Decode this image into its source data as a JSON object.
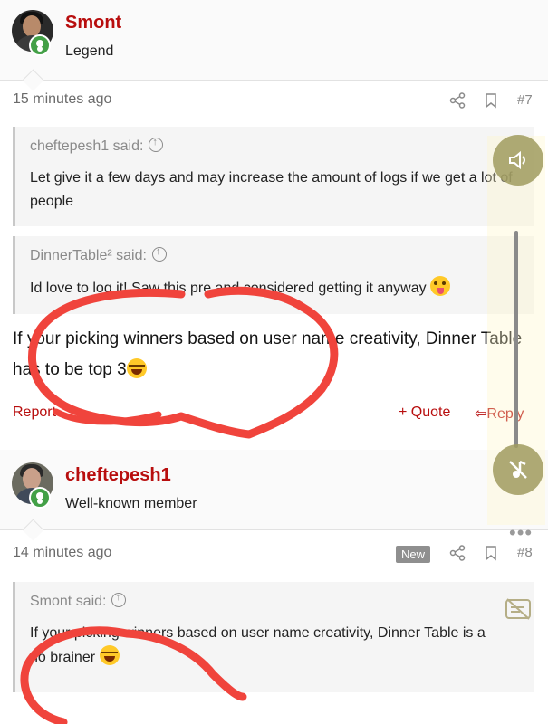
{
  "posts": [
    {
      "username": "Smont",
      "user_title": "Legend",
      "time": "15 minutes ago",
      "post_number": "#7",
      "quotes": [
        {
          "attribution": "cheftepesh1 said:",
          "text": "Let give it a few days and may increase the amount of logs if we get a lot of people"
        },
        {
          "attribution": "DinnerTable² said:",
          "text": "Id love to log it! Saw this pre and considered getting it anyway"
        }
      ],
      "message": "If your picking winners based on user name creativity, Dinner Table has to be top 3",
      "actions": {
        "report": "Report",
        "quote": "+ Quote",
        "reply": "Reply"
      }
    },
    {
      "username": "cheftepesh1",
      "user_title": "Well-known member",
      "time": "14 minutes ago",
      "badge": "New",
      "post_number": "#8",
      "quotes": [
        {
          "attribution": "Smont said:",
          "text": "If your picking winners based on user name creativity, Dinner Table is a no brainer"
        }
      ]
    }
  ],
  "icons": [
    "share-icon",
    "bookmark-icon",
    "volume-icon",
    "music-off-icon",
    "subtitles-off-icon",
    "more-dots-icon"
  ],
  "colors": {
    "accent": "#b80e0e",
    "online": "#43a047",
    "annotation": "#f0443c"
  },
  "overlay": {
    "more": "•••"
  }
}
